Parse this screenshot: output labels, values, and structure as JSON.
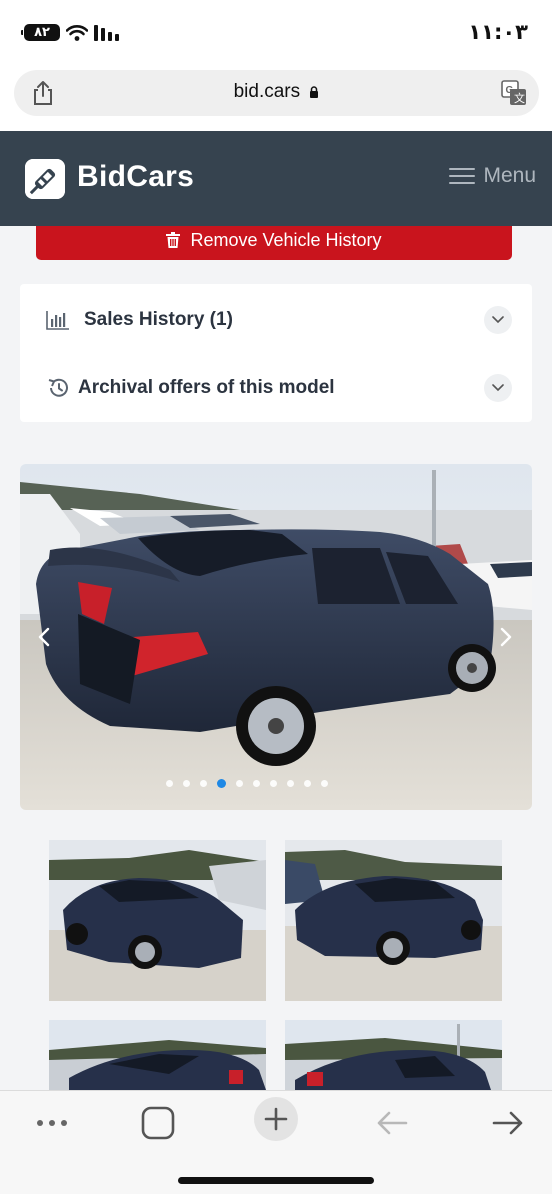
{
  "status_bar": {
    "battery": "۸۲",
    "time": "۱۱:۰۳"
  },
  "browser": {
    "url": "bid.cars",
    "icons": [
      "share-icon",
      "lock-icon",
      "translate-icon"
    ]
  },
  "site_header": {
    "logo_text": "BidCars",
    "menu_label": "Menu",
    "background": "#36434f"
  },
  "actions": {
    "remove_history_label": "Remove Vehicle History",
    "remove_color": "#c9141d"
  },
  "history_sections": [
    {
      "label": "Sales History (1)",
      "icon": "bar-chart-icon"
    },
    {
      "label": "Archival offers of this model",
      "icon": "history-icon"
    }
  ],
  "gallery": {
    "photo_count": 10,
    "active_index": 3,
    "main_photo": "rear three-quarter view of a dark blue sedan with rear damage in a salvage yard",
    "thumbnails": [
      "front view of dark blue sedan",
      "front view of dark blue sedan, driver side",
      "rear view of dark blue sedan",
      "rear view of dark blue sedan, passenger side"
    ],
    "accent_color": "#1e88e5"
  },
  "toolbar": {
    "buttons": [
      "more-icon",
      "tabs-icon",
      "new-tab-icon",
      "back-icon",
      "forward-icon"
    ]
  }
}
